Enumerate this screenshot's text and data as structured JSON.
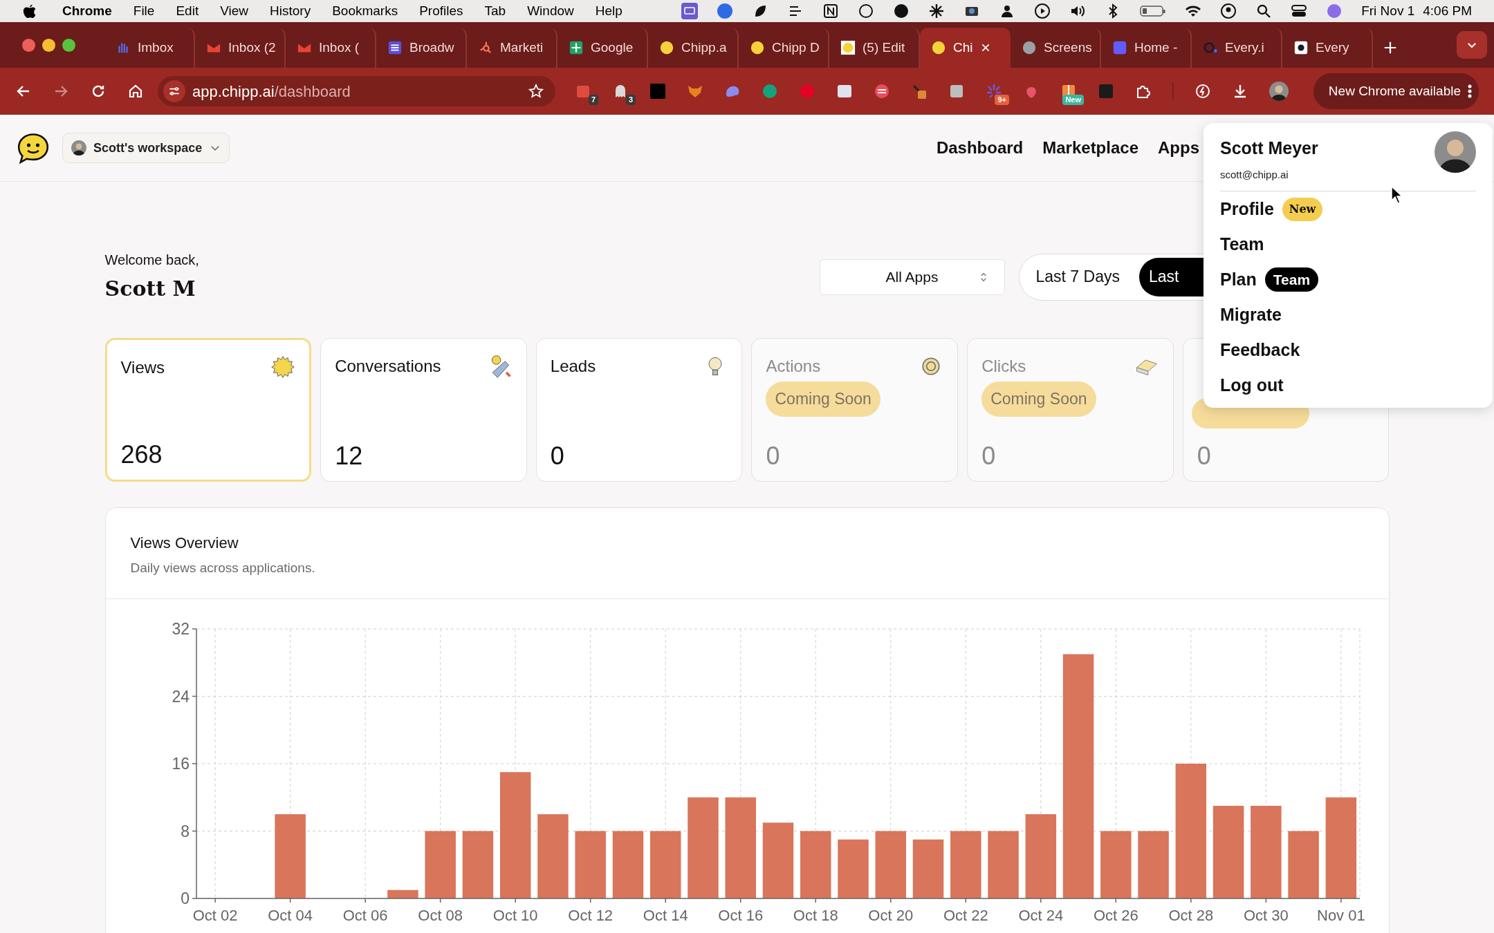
{
  "menu_bar": {
    "app_name": "Chrome",
    "menus": [
      "File",
      "Edit",
      "View",
      "History",
      "Bookmarks",
      "Profiles",
      "Tab",
      "Window",
      "Help"
    ],
    "date": "Fri Nov 1",
    "time": "4:06 PM"
  },
  "browser": {
    "tabs": [
      {
        "title": "Imbox",
        "selected": false
      },
      {
        "title": "Inbox (2",
        "selected": false
      },
      {
        "title": "Inbox (",
        "selected": false
      },
      {
        "title": "Broadw",
        "selected": false
      },
      {
        "title": "Marketi",
        "selected": false
      },
      {
        "title": "Google",
        "selected": false
      },
      {
        "title": "Chipp.a",
        "selected": false
      },
      {
        "title": "Chipp D",
        "selected": false
      },
      {
        "title": "(5) Edit",
        "selected": false
      },
      {
        "title": "Chi",
        "selected": true
      },
      {
        "title": "Screens",
        "selected": false
      },
      {
        "title": "Home -",
        "selected": false
      },
      {
        "title": "Every.i",
        "selected": false
      },
      {
        "title": "Every",
        "selected": false
      }
    ],
    "address": {
      "host": "app.chipp.ai",
      "path": "/dashboard"
    },
    "extension_badges": [
      "7",
      "3",
      "9+",
      "New"
    ],
    "update_button": "New Chrome available"
  },
  "header": {
    "workspace": "Scott's workspace",
    "nav": [
      "Dashboard",
      "Marketplace",
      "Apps"
    ]
  },
  "greeting": {
    "welcome": "Welcome back,",
    "name": "Scott M"
  },
  "filters": {
    "app_select": "All Apps",
    "ranges": [
      {
        "label": "Last 7 Days",
        "selected": false
      },
      {
        "label": "Last",
        "selected": true
      }
    ]
  },
  "stats": [
    {
      "title": "Views",
      "value": "268",
      "selected": true,
      "disabled": false
    },
    {
      "title": "Conversations",
      "value": "12",
      "selected": false,
      "disabled": false
    },
    {
      "title": "Leads",
      "value": "0",
      "selected": false,
      "disabled": false
    },
    {
      "title": "Actions",
      "badge": "Coming Soon",
      "value": "0",
      "selected": false,
      "disabled": true
    },
    {
      "title": "Clicks",
      "badge": "Coming Soon",
      "value": "0",
      "selected": false,
      "disabled": true
    },
    {
      "badge_partial": true,
      "value": "0",
      "selected": false,
      "disabled": true
    }
  ],
  "chart_card": {
    "title": "Views Overview",
    "subtitle": "Daily views across applications.",
    "chart_data": {
      "type": "bar",
      "grid": true,
      "ylim": [
        0,
        32
      ],
      "yticks": [
        0,
        8,
        16,
        24,
        32
      ],
      "categories": [
        "Oct 02",
        null,
        "Oct 04",
        null,
        "Oct 06",
        null,
        "Oct 08",
        null,
        "Oct 10",
        null,
        "Oct 12",
        null,
        "Oct 14",
        null,
        "Oct 16",
        null,
        "Oct 18",
        null,
        "Oct 20",
        null,
        "Oct 22",
        null,
        "Oct 24",
        null,
        "Oct 26",
        null,
        "Oct 28",
        null,
        "Oct 30",
        null,
        "Nov 01"
      ],
      "values": [
        0,
        0,
        10,
        0,
        0,
        1,
        8,
        8,
        15,
        10,
        8,
        8,
        8,
        12,
        12,
        9,
        8,
        7,
        8,
        7,
        8,
        8,
        10,
        29,
        8,
        8,
        16,
        11,
        11,
        8,
        12
      ]
    }
  },
  "user_menu": {
    "name": "Scott Meyer",
    "email": "scott@chipp.ai",
    "items": [
      {
        "label": "Profile",
        "badge": {
          "text": "New",
          "kind": "new"
        }
      },
      {
        "label": "Team"
      },
      {
        "label": "Plan",
        "badge": {
          "text": "Team",
          "kind": "plan"
        }
      },
      {
        "label": "Migrate"
      },
      {
        "label": "Feedback"
      },
      {
        "label": "Log out"
      }
    ]
  }
}
